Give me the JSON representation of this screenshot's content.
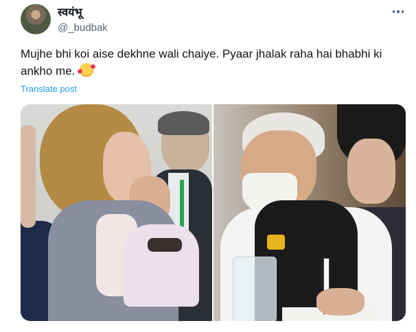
{
  "author": {
    "display_name": "स्वयंभू",
    "handle": "@_budbak"
  },
  "post": {
    "text": "Mujhe bhi koi aise dekhne wali chaiye. Pyaar jhalak raha hai bhabhi ki ankho me.",
    "emoji": "smiling-face-with-hearts-icon",
    "translate_label": "Translate post"
  },
  "media": {
    "count": 2
  },
  "colors": {
    "text": "#0f1419",
    "secondary": "#536471",
    "link": "#1d9bf0",
    "background": "#ffffff"
  }
}
